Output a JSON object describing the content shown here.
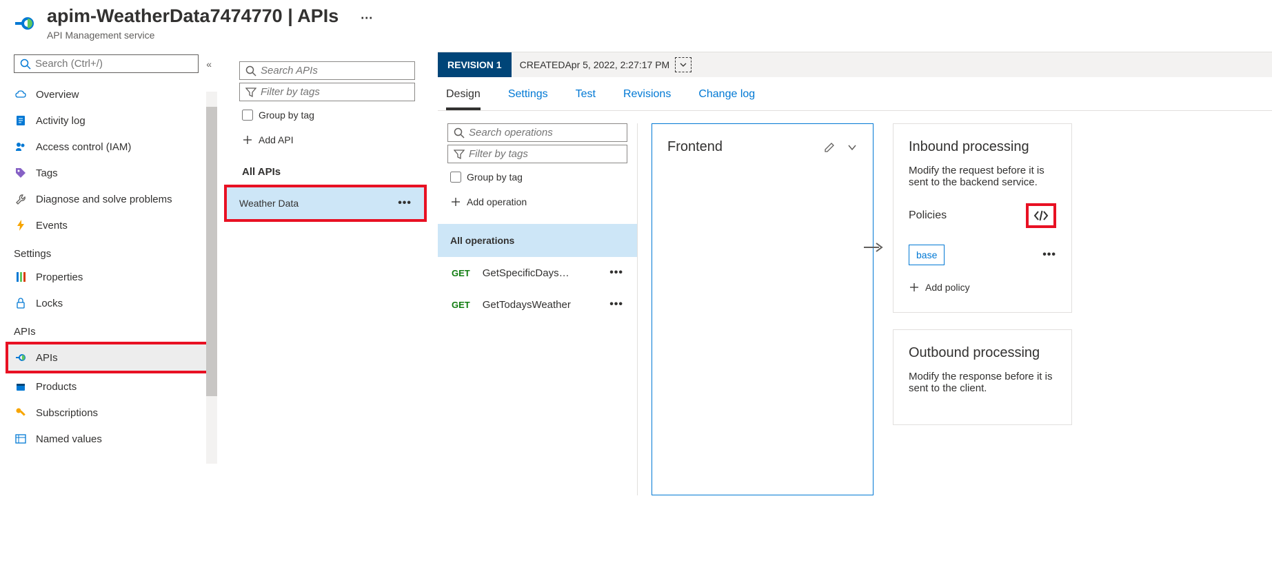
{
  "header": {
    "title_prefix": "apim-WeatherData7474770",
    "title_sep": " | ",
    "title_suffix": "APIs",
    "subtitle": "API Management service"
  },
  "leftnav": {
    "search_placeholder": "Search (Ctrl+/)",
    "items_top": [
      {
        "label": "Overview",
        "icon": "cloud"
      },
      {
        "label": "Activity log",
        "icon": "log"
      },
      {
        "label": "Access control (IAM)",
        "icon": "people"
      },
      {
        "label": "Tags",
        "icon": "tag"
      },
      {
        "label": "Diagnose and solve problems",
        "icon": "wrench"
      },
      {
        "label": "Events",
        "icon": "bolt"
      }
    ],
    "settings_label": "Settings",
    "items_settings": [
      {
        "label": "Properties",
        "icon": "props"
      },
      {
        "label": "Locks",
        "icon": "lock"
      }
    ],
    "apis_label": "APIs",
    "items_apis": [
      {
        "label": "APIs",
        "icon": "api",
        "selected": true,
        "highlight": true
      },
      {
        "label": "Products",
        "icon": "products"
      },
      {
        "label": "Subscriptions",
        "icon": "key"
      },
      {
        "label": "Named values",
        "icon": "namedvalues"
      }
    ]
  },
  "api_list": {
    "search_placeholder": "Search APIs",
    "filter_placeholder": "Filter by tags",
    "group_by_label": "Group by tag",
    "add_api_label": "Add API",
    "all_apis_label": "All APIs",
    "apis": [
      {
        "name": "Weather Data",
        "highlight": true
      }
    ]
  },
  "main": {
    "revision_label": "REVISION 1",
    "created_prefix": "CREATED ",
    "created_value": "Apr 5, 2022, 2:27:17 PM",
    "tabs": [
      {
        "label": "Design",
        "active": true
      },
      {
        "label": "Settings"
      },
      {
        "label": "Test"
      },
      {
        "label": "Revisions"
      },
      {
        "label": "Change log"
      }
    ],
    "operations": {
      "search_placeholder": "Search operations",
      "filter_placeholder": "Filter by tags",
      "group_by_label": "Group by tag",
      "add_operation_label": "Add operation",
      "all_operations_label": "All operations",
      "ops": [
        {
          "method": "GET",
          "name": "GetSpecificDays…"
        },
        {
          "method": "GET",
          "name": "GetTodaysWeather"
        }
      ]
    },
    "frontend": {
      "title": "Frontend"
    },
    "inbound": {
      "title": "Inbound processing",
      "desc": "Modify the request before it is sent to the backend service.",
      "policies_label": "Policies",
      "base_label": "base",
      "add_policy_label": "Add policy"
    },
    "outbound": {
      "title": "Outbound processing",
      "desc": "Modify the response before it is sent to the client."
    }
  }
}
